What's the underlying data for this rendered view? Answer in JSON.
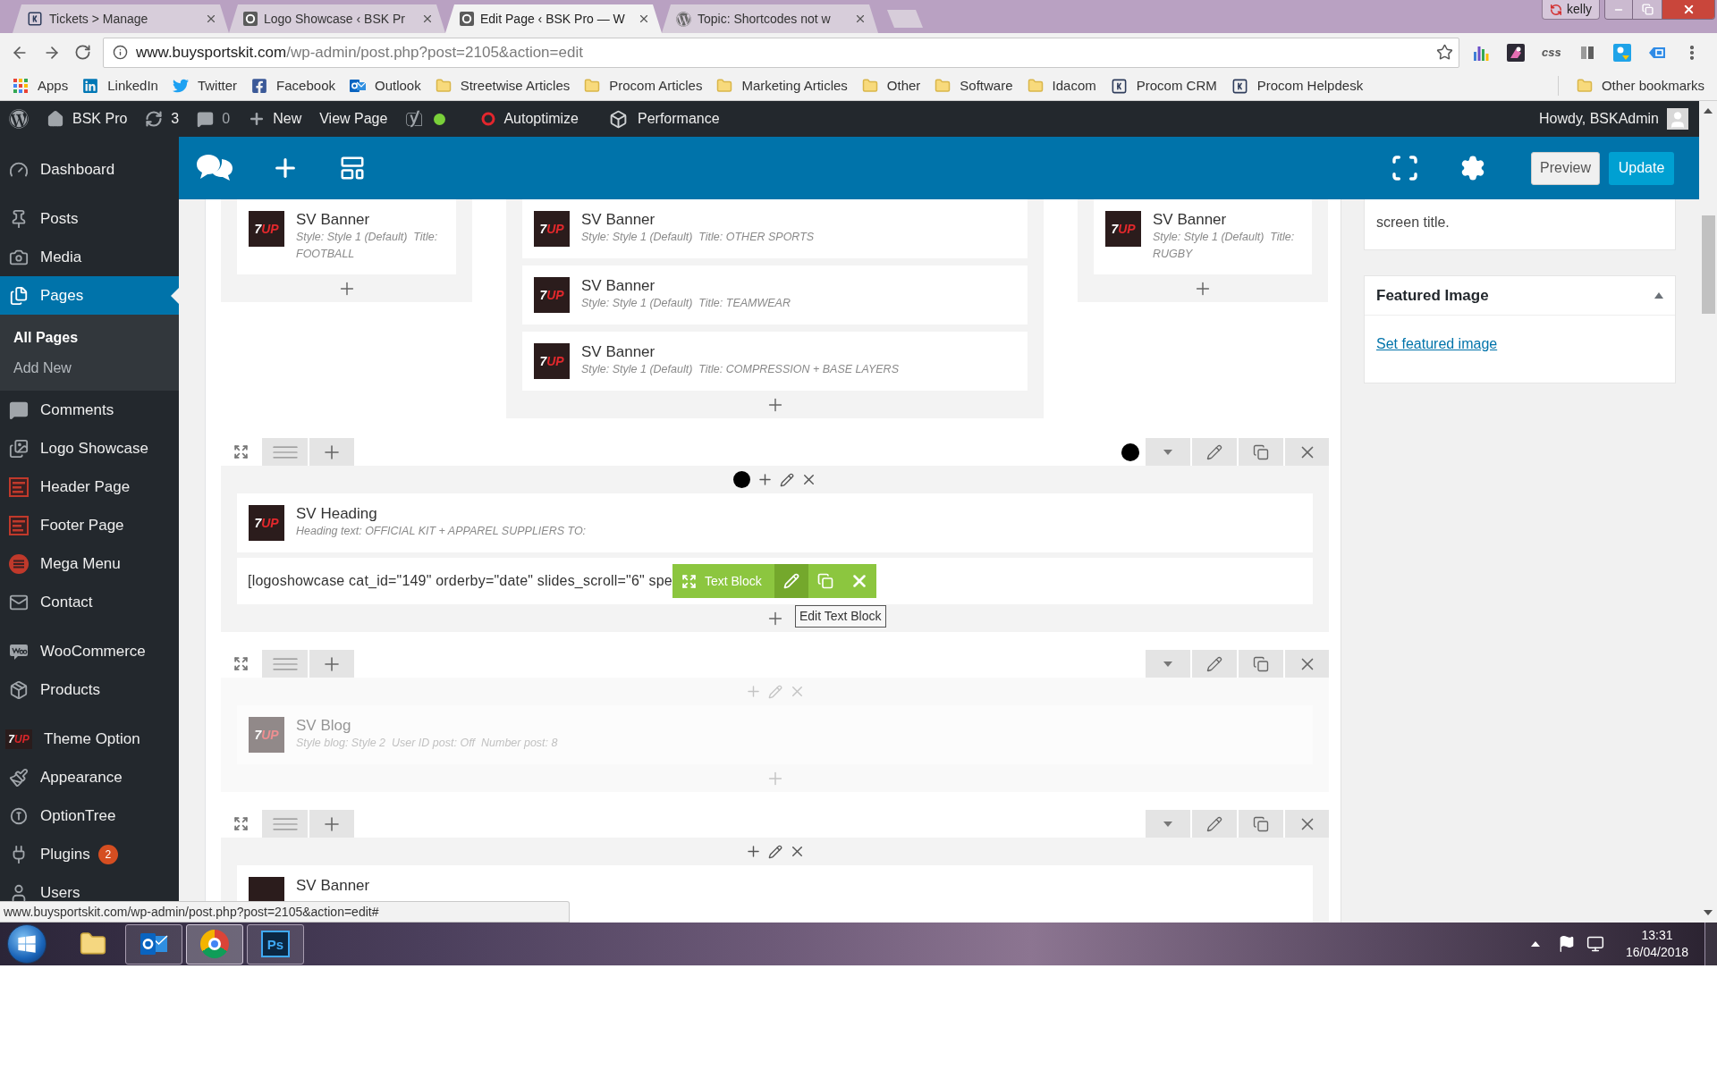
{
  "browser": {
    "tabs": [
      {
        "title": "Tickets > Manage",
        "kind": "letter",
        "selected": false
      },
      {
        "title": "Logo Showcase ‹ BSK Pr",
        "kind": "site",
        "selected": false
      },
      {
        "title": "Edit Page ‹ BSK Pro — W",
        "kind": "site",
        "selected": true
      },
      {
        "title": "Topic: Shortcodes not w",
        "kind": "wordpress",
        "selected": false
      }
    ],
    "profile": "kelly",
    "address": {
      "host": "www.buysportskit.com",
      "path": "/wp-admin/post.php?post=2105&action=edit"
    },
    "extension_label": "css",
    "bookmarks": [
      {
        "label": "Apps",
        "kind": "apps"
      },
      {
        "label": "LinkedIn",
        "kind": "linkedin"
      },
      {
        "label": "Twitter",
        "kind": "twitter"
      },
      {
        "label": "Facebook",
        "kind": "facebook"
      },
      {
        "label": "Outlook",
        "kind": "outlook"
      },
      {
        "label": "Streetwise Articles",
        "kind": "folder"
      },
      {
        "label": "Procom Articles",
        "kind": "folder"
      },
      {
        "label": "Marketing Articles",
        "kind": "folder"
      },
      {
        "label": "Other",
        "kind": "folder"
      },
      {
        "label": "Software",
        "kind": "folder"
      },
      {
        "label": "Idacom",
        "kind": "folder"
      },
      {
        "label": "Procom CRM",
        "kind": "letter"
      },
      {
        "label": "Procom Helpdesk",
        "kind": "letter"
      }
    ],
    "other_bookmarks": "Other bookmarks"
  },
  "admin_bar": {
    "site": "BSK Pro",
    "updates": "3",
    "comments": "0",
    "new": "New",
    "view_page": "View Page",
    "autoptimize": "Autoptimize",
    "performance": "Performance",
    "greeting": "Howdy, BSKAdmin"
  },
  "sidebar": {
    "groups": [
      {
        "items": [
          {
            "label": "Dashboard",
            "kind": "dashboard",
            "selected": false
          }
        ]
      },
      {
        "items": [
          {
            "label": "Posts",
            "kind": "posts",
            "selected": false
          },
          {
            "label": "Media",
            "kind": "media",
            "selected": false
          },
          {
            "label": "Pages",
            "kind": "pages",
            "selected": true,
            "children": [
              {
                "label": "All Pages",
                "selected": true
              },
              {
                "label": "Add New",
                "selected": false
              }
            ]
          },
          {
            "label": "Comments",
            "kind": "comments",
            "selected": false
          },
          {
            "label": "Logo Showcase",
            "kind": "gallery",
            "selected": false
          },
          {
            "label": "Header Page",
            "kind": "layout",
            "selected": false
          },
          {
            "label": "Footer Page",
            "kind": "layout",
            "selected": false
          },
          {
            "label": "Mega Menu",
            "kind": "menu",
            "selected": false
          },
          {
            "label": "Contact",
            "kind": "mail",
            "selected": false
          }
        ]
      },
      {
        "items": [
          {
            "label": "WooCommerce",
            "kind": "woo",
            "selected": false
          },
          {
            "label": "Products",
            "kind": "products",
            "selected": false
          }
        ]
      },
      {
        "items": [
          {
            "label": "Theme Option",
            "kind": "logo",
            "glyph": "7UP",
            "selected": false
          },
          {
            "label": "Appearance",
            "kind": "appearance",
            "selected": false
          },
          {
            "label": "OptionTree",
            "kind": "optiontree",
            "selected": false
          },
          {
            "label": "Plugins",
            "kind": "plugins",
            "badge": "2",
            "selected": false
          },
          {
            "label": "Users",
            "kind": "users",
            "selected": false
          }
        ]
      }
    ]
  },
  "builder": {
    "preview": "Preview",
    "update": "Update"
  },
  "columns": [
    {
      "elements": [
        {
          "title": "SV Banner",
          "details": "Style: Style 1 (Default)  Title: FOOTBALL",
          "thumb": "7UP"
        }
      ]
    },
    {
      "elements": [
        {
          "title": "SV Banner",
          "details": "Style: Style 1 (Default)  Title: OTHER SPORTS",
          "thumb": "7UP"
        },
        {
          "title": "SV Banner",
          "details": "Style: Style 1 (Default)  Title: TEAMWEAR",
          "thumb": "7UP"
        },
        {
          "title": "SV Banner",
          "details": "Style: Style 1 (Default)  Title: COMPRESSION + BASE LAYERS",
          "thumb": "7UP"
        }
      ]
    },
    {
      "elements": [
        {
          "title": "SV Banner",
          "details": "Style: Style 1 (Default)  Title: RUGBY",
          "thumb": "7UP"
        }
      ]
    }
  ],
  "rows": [
    {
      "disabled": false,
      "marked": true,
      "elements": [
        {
          "kind": "element",
          "title": "SV Heading",
          "details": "Heading text: OFFICIAL KIT + APPAREL SUPPLIERS TO:",
          "thumb": "7UP"
        },
        {
          "kind": "text",
          "text": "[logoshowcase cat_id=\"149\" orderby=\"date\" slides_scroll=\"6\" spe",
          "toolbar": "Text Block",
          "tooltip": "Edit Text Block"
        }
      ]
    },
    {
      "disabled": true,
      "marked": false,
      "elements": [
        {
          "kind": "element",
          "title": "SV Blog",
          "details": "Style blog: Style 2  User ID post: Off  Number post: 8",
          "thumb": "7UP"
        }
      ]
    },
    {
      "disabled": false,
      "marked": false,
      "elements": [
        {
          "kind": "element",
          "title": "SV Banner"
        }
      ]
    }
  ],
  "side_panel": {
    "help": "screen title.",
    "featured": {
      "title": "Featured Image",
      "expanded": true,
      "link": "Set featured image"
    }
  },
  "status_url": "www.buysportskit.com/wp-admin/post.php?post=2105&action=edit#",
  "taskbar": {
    "apps": [
      {
        "kind": "explorer",
        "running": false,
        "selected": false
      },
      {
        "kind": "outlook",
        "running": true,
        "selected": false
      },
      {
        "kind": "chrome",
        "running": true,
        "selected": true
      },
      {
        "kind": "photoshop",
        "label": "Ps",
        "running": true,
        "selected": false
      }
    ],
    "time": "13:31",
    "date": "16/04/2018"
  }
}
